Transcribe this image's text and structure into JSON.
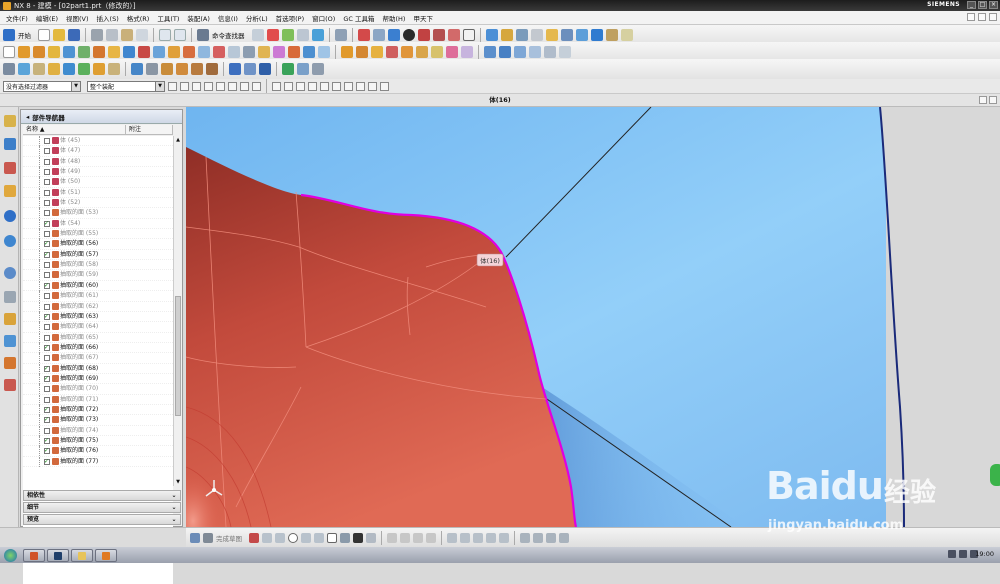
{
  "window": {
    "title": "NX 8 - 建模 - [02part1.prt（修改的）]",
    "brand": "SIEMENS",
    "controls": [
      "_",
      "□",
      "×"
    ]
  },
  "menubar": {
    "items": [
      "文件(F)",
      "编辑(E)",
      "视图(V)",
      "插入(S)",
      "格式(R)",
      "工具(T)",
      "装配(A)",
      "信息(I)",
      "分析(L)",
      "首选项(P)",
      "窗口(O)",
      "GC 工具箱",
      "帮助(H)",
      "甲天下"
    ]
  },
  "toolbar1": {
    "start_label": "开始",
    "command_finder_label": "命令查找器"
  },
  "selection_bar": {
    "filter_value": "没有选择过滤器",
    "scope_value": "整个装配"
  },
  "view": {
    "title": "体(16)",
    "tooltip": "体(16)"
  },
  "part_navigator": {
    "title": "部件导航器",
    "columns": [
      "名称",
      "附注"
    ],
    "rows": [
      {
        "label": "体 (45)",
        "checked": false,
        "dim": true,
        "kind": "body"
      },
      {
        "label": "体 (47)",
        "checked": false,
        "dim": true,
        "kind": "body"
      },
      {
        "label": "体 (48)",
        "checked": false,
        "dim": true,
        "kind": "body"
      },
      {
        "label": "体 (49)",
        "checked": false,
        "dim": true,
        "kind": "body"
      },
      {
        "label": "体 (50)",
        "checked": false,
        "dim": true,
        "kind": "body"
      },
      {
        "label": "体 (51)",
        "checked": false,
        "dim": true,
        "kind": "body"
      },
      {
        "label": "体 (52)",
        "checked": false,
        "dim": true,
        "kind": "body"
      },
      {
        "label": "抽取的面 (53)",
        "checked": false,
        "dim": true,
        "kind": "face"
      },
      {
        "label": "体 (54)",
        "checked": true,
        "dim": true,
        "kind": "body"
      },
      {
        "label": "抽取的面 (55)",
        "checked": false,
        "dim": true,
        "kind": "face"
      },
      {
        "label": "抽取的面 (56)",
        "checked": true,
        "dim": false,
        "kind": "face"
      },
      {
        "label": "抽取的面 (57)",
        "checked": true,
        "dim": false,
        "kind": "face"
      },
      {
        "label": "抽取的面 (58)",
        "checked": false,
        "dim": true,
        "kind": "face"
      },
      {
        "label": "抽取的面 (59)",
        "checked": false,
        "dim": true,
        "kind": "face"
      },
      {
        "label": "抽取的面 (60)",
        "checked": true,
        "dim": false,
        "kind": "face"
      },
      {
        "label": "抽取的面 (61)",
        "checked": false,
        "dim": true,
        "kind": "face"
      },
      {
        "label": "抽取的面 (62)",
        "checked": false,
        "dim": true,
        "kind": "face"
      },
      {
        "label": "抽取的面 (63)",
        "checked": true,
        "dim": false,
        "kind": "face"
      },
      {
        "label": "抽取的面 (64)",
        "checked": false,
        "dim": true,
        "kind": "face"
      },
      {
        "label": "抽取的面 (65)",
        "checked": false,
        "dim": true,
        "kind": "face"
      },
      {
        "label": "抽取的面 (66)",
        "checked": true,
        "dim": false,
        "kind": "face"
      },
      {
        "label": "抽取的面 (67)",
        "checked": false,
        "dim": true,
        "kind": "face"
      },
      {
        "label": "抽取的面 (68)",
        "checked": true,
        "dim": false,
        "kind": "face"
      },
      {
        "label": "抽取的面 (69)",
        "checked": true,
        "dim": false,
        "kind": "face"
      },
      {
        "label": "抽取的面 (70)",
        "checked": false,
        "dim": true,
        "kind": "face"
      },
      {
        "label": "抽取的面 (71)",
        "checked": false,
        "dim": true,
        "kind": "face"
      },
      {
        "label": "抽取的面 (72)",
        "checked": true,
        "dim": false,
        "kind": "face"
      },
      {
        "label": "抽取的面 (73)",
        "checked": true,
        "dim": false,
        "kind": "face"
      },
      {
        "label": "抽取的面 (74)",
        "checked": false,
        "dim": true,
        "kind": "face"
      },
      {
        "label": "抽取的面 (75)",
        "checked": true,
        "dim": false,
        "kind": "face"
      },
      {
        "label": "抽取的面 (76)",
        "checked": true,
        "dim": false,
        "kind": "face"
      },
      {
        "label": "抽取的面 (77)",
        "checked": true,
        "dim": false,
        "kind": "face"
      }
    ],
    "panels": [
      "相依性",
      "细节",
      "预览"
    ]
  },
  "bottom_toolbar": {
    "sketch_label": "完成草图"
  },
  "taskbar": {
    "clock": "19:00"
  },
  "watermark": {
    "brand": "Baidu",
    "cn": "经验",
    "url": "jingyan.baidu.com"
  },
  "colors": {
    "viewport_bg": "#8fcdf9",
    "model_red": "#c4473a",
    "highlight": "#e000e0",
    "title_bg": "#1d1d1d"
  }
}
